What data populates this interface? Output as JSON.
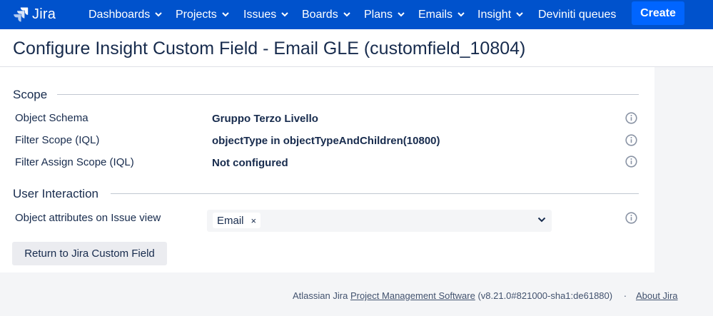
{
  "nav": {
    "logo_text": "Jira",
    "items": [
      {
        "label": "Dashboards",
        "has_dropdown": true
      },
      {
        "label": "Projects",
        "has_dropdown": true
      },
      {
        "label": "Issues",
        "has_dropdown": true
      },
      {
        "label": "Boards",
        "has_dropdown": true
      },
      {
        "label": "Plans",
        "has_dropdown": true
      },
      {
        "label": "Emails",
        "has_dropdown": true
      },
      {
        "label": "Insight",
        "has_dropdown": true
      },
      {
        "label": "Deviniti queues",
        "has_dropdown": false
      }
    ],
    "create_label": "Create",
    "bar_color": "#0052cc",
    "create_color": "#0065ff"
  },
  "page": {
    "title": "Configure Insight Custom Field - Email GLE (customfield_10804)"
  },
  "scope": {
    "heading": "Scope",
    "rows": [
      {
        "label": "Object Schema",
        "value": "Gruppo Terzo Livello"
      },
      {
        "label": "Filter Scope (IQL)",
        "value": "objectType in objectTypeAndChildren(10800)"
      },
      {
        "label": "Filter Assign Scope (IQL)",
        "value": "Not configured"
      }
    ]
  },
  "user_interaction": {
    "heading": "User Interaction",
    "attributes_label": "Object attributes on Issue view",
    "selected_tags": [
      "Email"
    ],
    "remove_glyph": "×"
  },
  "actions": {
    "return_label": "Return to Jira Custom Field"
  },
  "footer": {
    "prefix": "Atlassian Jira",
    "link_text": "Project Management Software",
    "version": "(v8.21.0#821000-sha1:de61880)",
    "separator": "·",
    "about_label": "About Jira"
  }
}
